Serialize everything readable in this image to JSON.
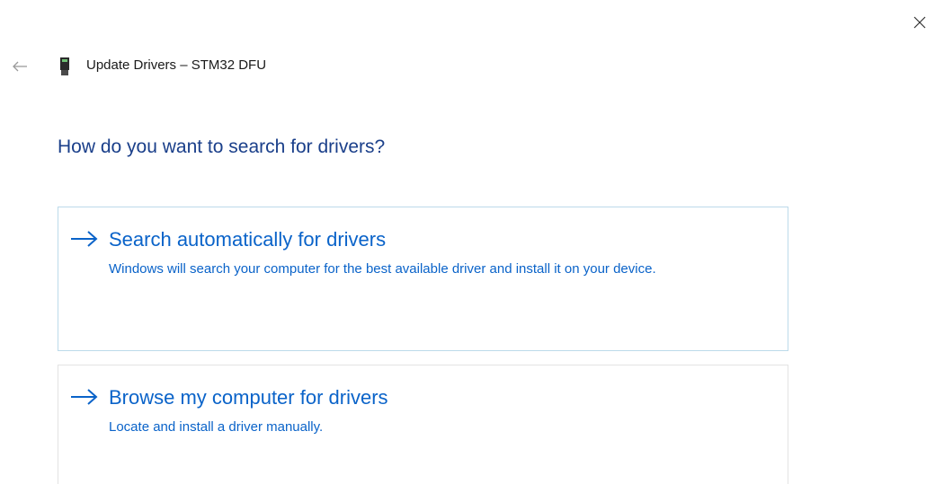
{
  "window": {
    "title": "Update Drivers – STM32 DFU"
  },
  "heading": "How do you want to search for drivers?",
  "options": [
    {
      "title": "Search automatically for drivers",
      "description": "Windows will search your computer for the best available driver and install it on your device."
    },
    {
      "title": "Browse my computer for drivers",
      "description": "Locate and install a driver manually."
    }
  ],
  "icons": {
    "close": "close-icon",
    "back": "back-arrow-icon",
    "device": "usb-device-icon",
    "option_arrow": "arrow-right-icon"
  },
  "colors": {
    "heading": "#1a3f8a",
    "link": "#0a63c9",
    "border_active": "#bcdaea",
    "border": "#e3e3e3"
  }
}
